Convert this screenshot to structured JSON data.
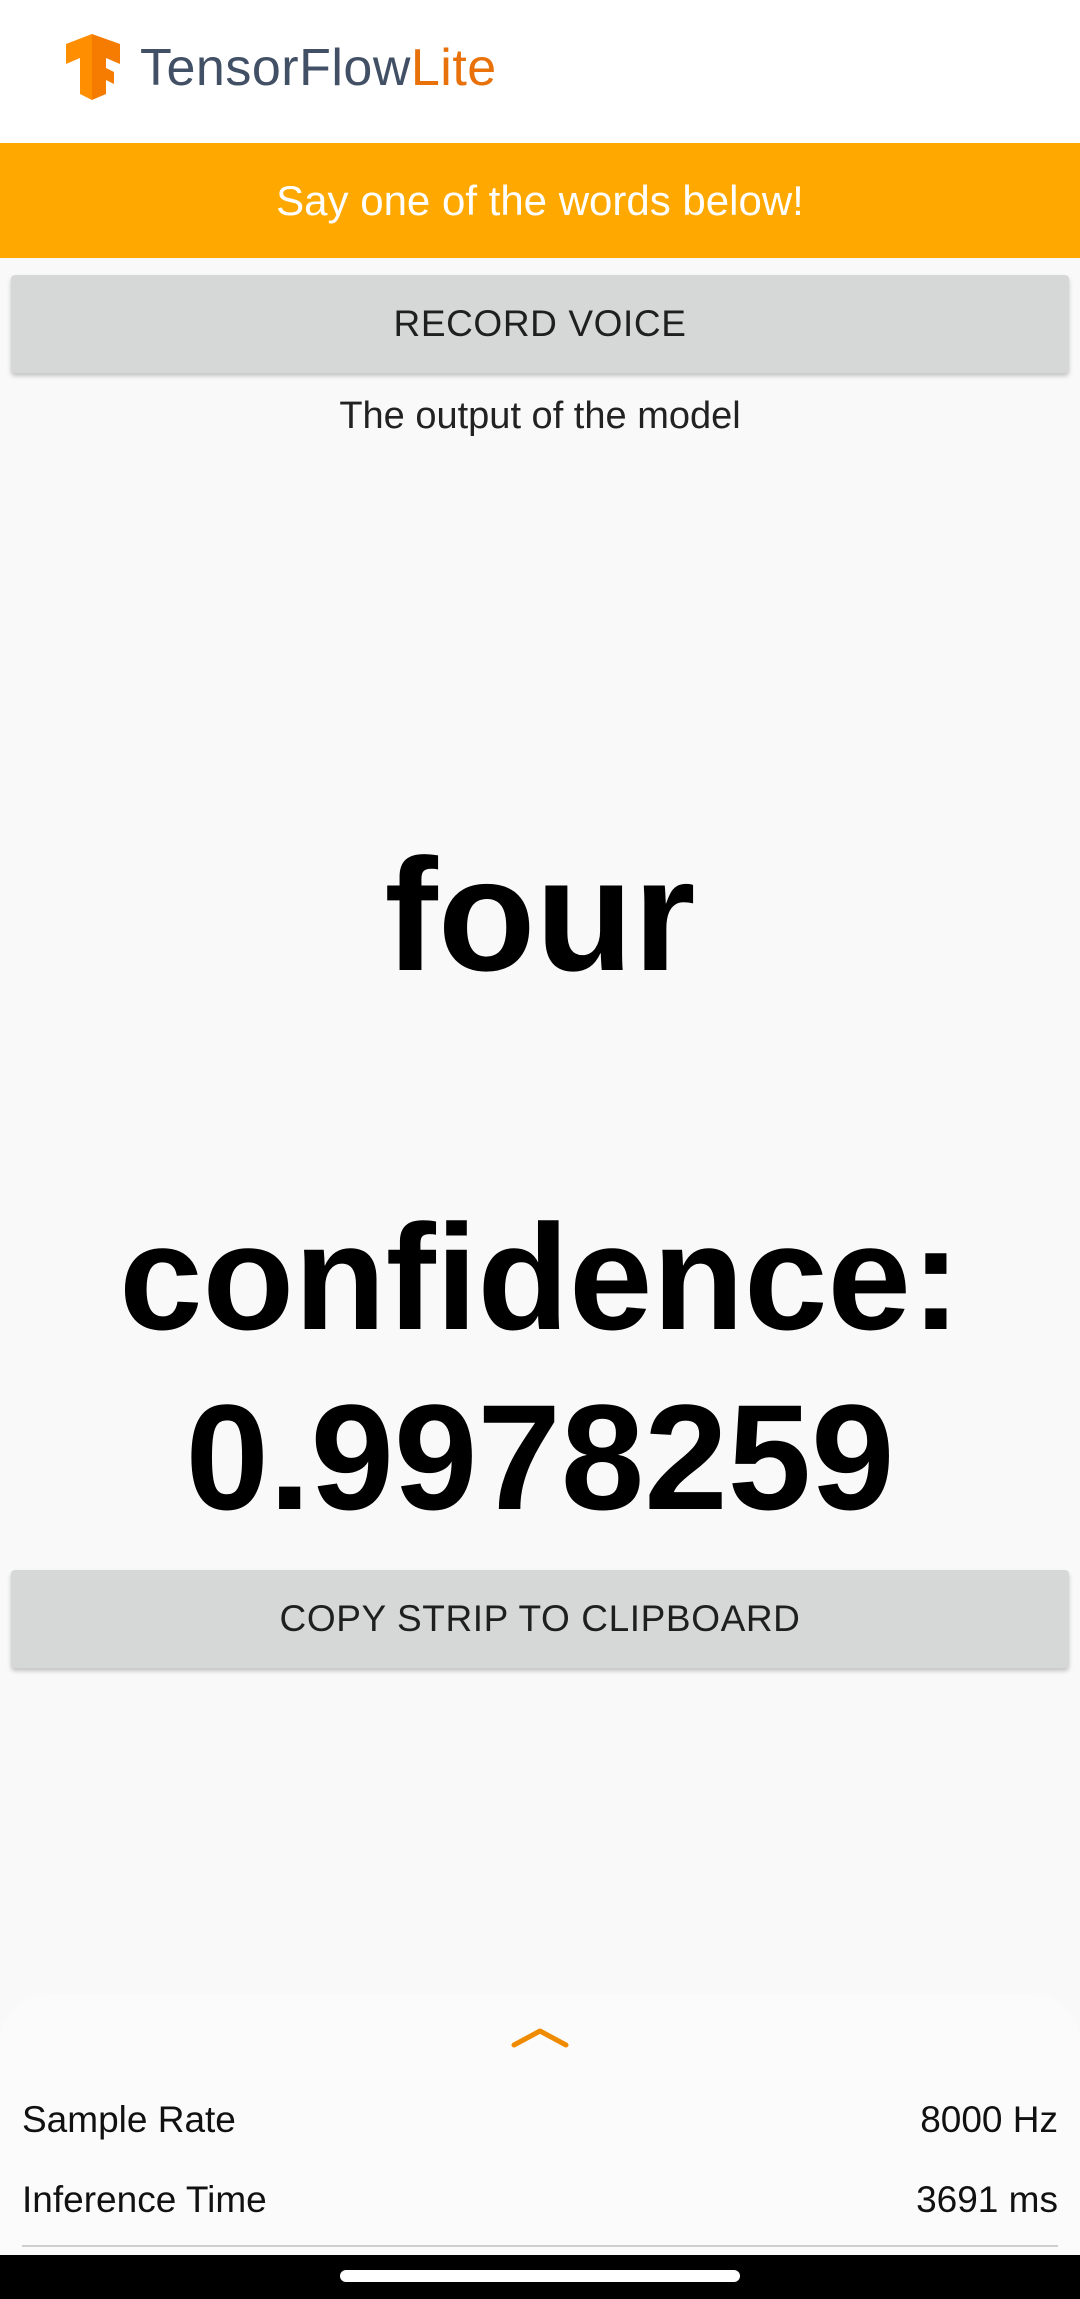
{
  "app": {
    "logo_text_primary": "TensorFlow",
    "logo_text_accent": "Lite",
    "logo_icon": "tensorflow-logo-icon",
    "brand_color": "#ffa800",
    "accent_color": "#e8710a"
  },
  "banner": {
    "text": "Say one of the words below!"
  },
  "buttons": {
    "record_label": "RECORD VOICE",
    "copy_label": "COPY STRIP TO CLIPBOARD"
  },
  "output": {
    "caption": "The output of the model",
    "word": "four",
    "confidence_label": "confidence:",
    "confidence_value": "0.9978259"
  },
  "bottom_sheet": {
    "toggle_icon": "chevron-up-icon",
    "rows": [
      {
        "label": "Sample Rate",
        "value": "8000 Hz"
      },
      {
        "label": "Inference Time",
        "value": "3691 ms"
      }
    ]
  }
}
